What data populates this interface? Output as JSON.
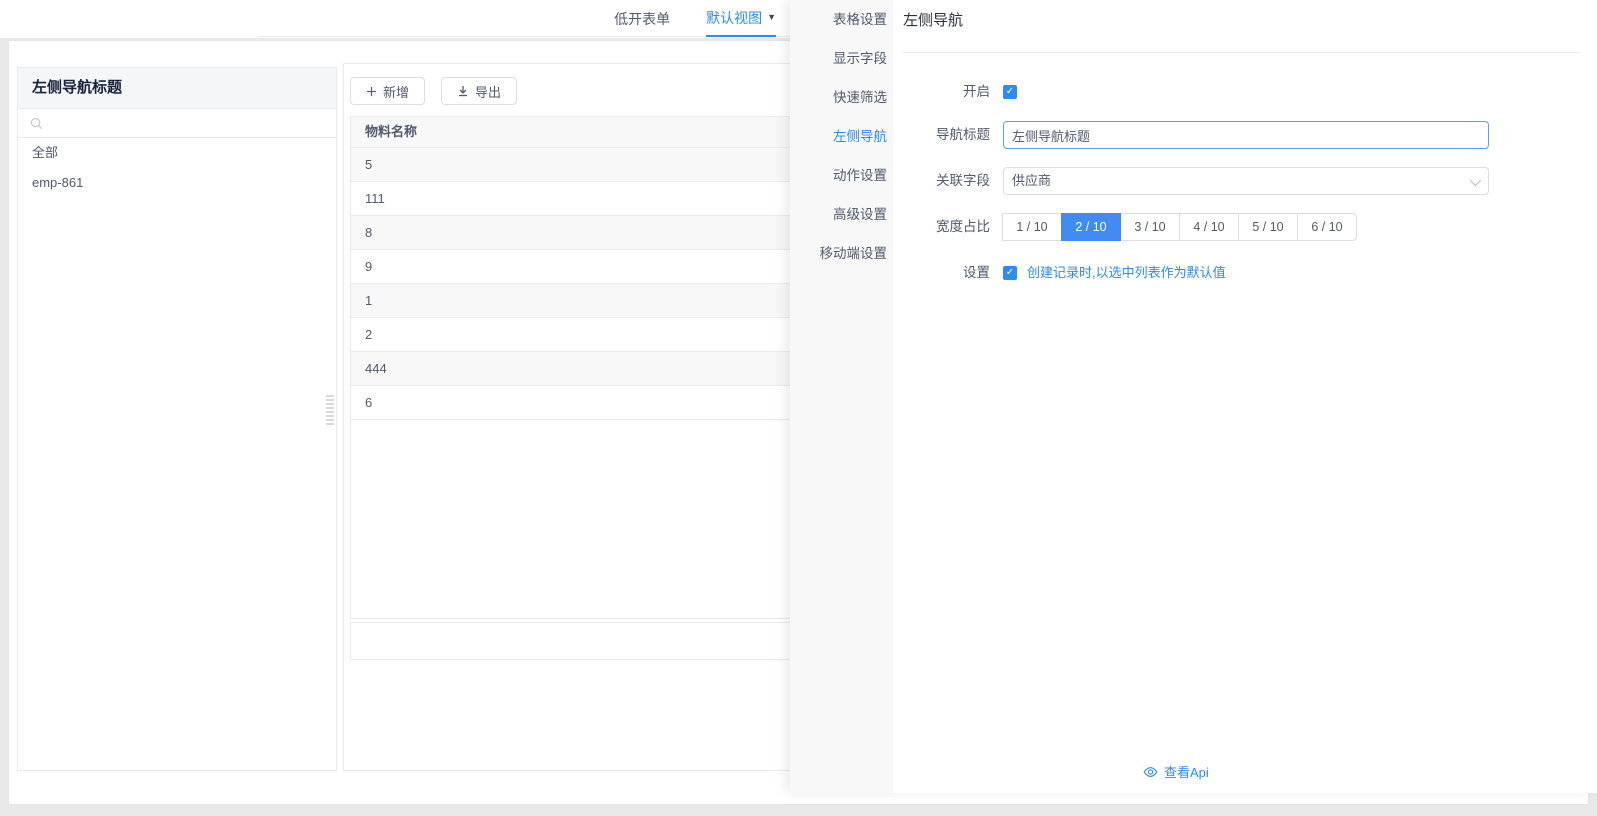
{
  "accent": "#2d8cf0",
  "topbar": {
    "tabs": [
      {
        "label": "低开表单",
        "caret": ""
      },
      {
        "label": "默认视图",
        "caret": "▼",
        "active": true
      }
    ]
  },
  "left_nav": {
    "title": "左侧导航标题",
    "items": [
      "全部",
      "emp-861"
    ]
  },
  "toolbar": {
    "add_label": "新增",
    "export_label": "导出"
  },
  "table": {
    "columns": [
      "物料名称"
    ],
    "rows": [
      "5",
      "111",
      "8",
      "9",
      "1",
      "2",
      "444",
      "6"
    ]
  },
  "settings": {
    "menu": [
      {
        "label": "表格设置"
      },
      {
        "label": "显示字段"
      },
      {
        "label": "快速筛选"
      },
      {
        "label": "左侧导航",
        "active": true
      },
      {
        "label": "动作设置"
      },
      {
        "label": "高级设置"
      },
      {
        "label": "移动端设置"
      }
    ],
    "panel_title": "左侧导航",
    "form": {
      "enable_label": "开启",
      "nav_title_label": "导航标题",
      "nav_title_value": "左侧导航标题",
      "related_field_label": "关联字段",
      "related_field_value": "供应商",
      "width_label": "宽度占比",
      "width_options": [
        {
          "label": "1 / 10"
        },
        {
          "label": "2 / 10",
          "selected": true
        },
        {
          "label": "3 / 10"
        },
        {
          "label": "4 / 10"
        },
        {
          "label": "5 / 10"
        },
        {
          "label": "6 / 10"
        }
      ],
      "settings_label": "设置",
      "settings_option": "创建记录时,以选中列表作为默认值"
    },
    "footer_link": "查看Api"
  }
}
